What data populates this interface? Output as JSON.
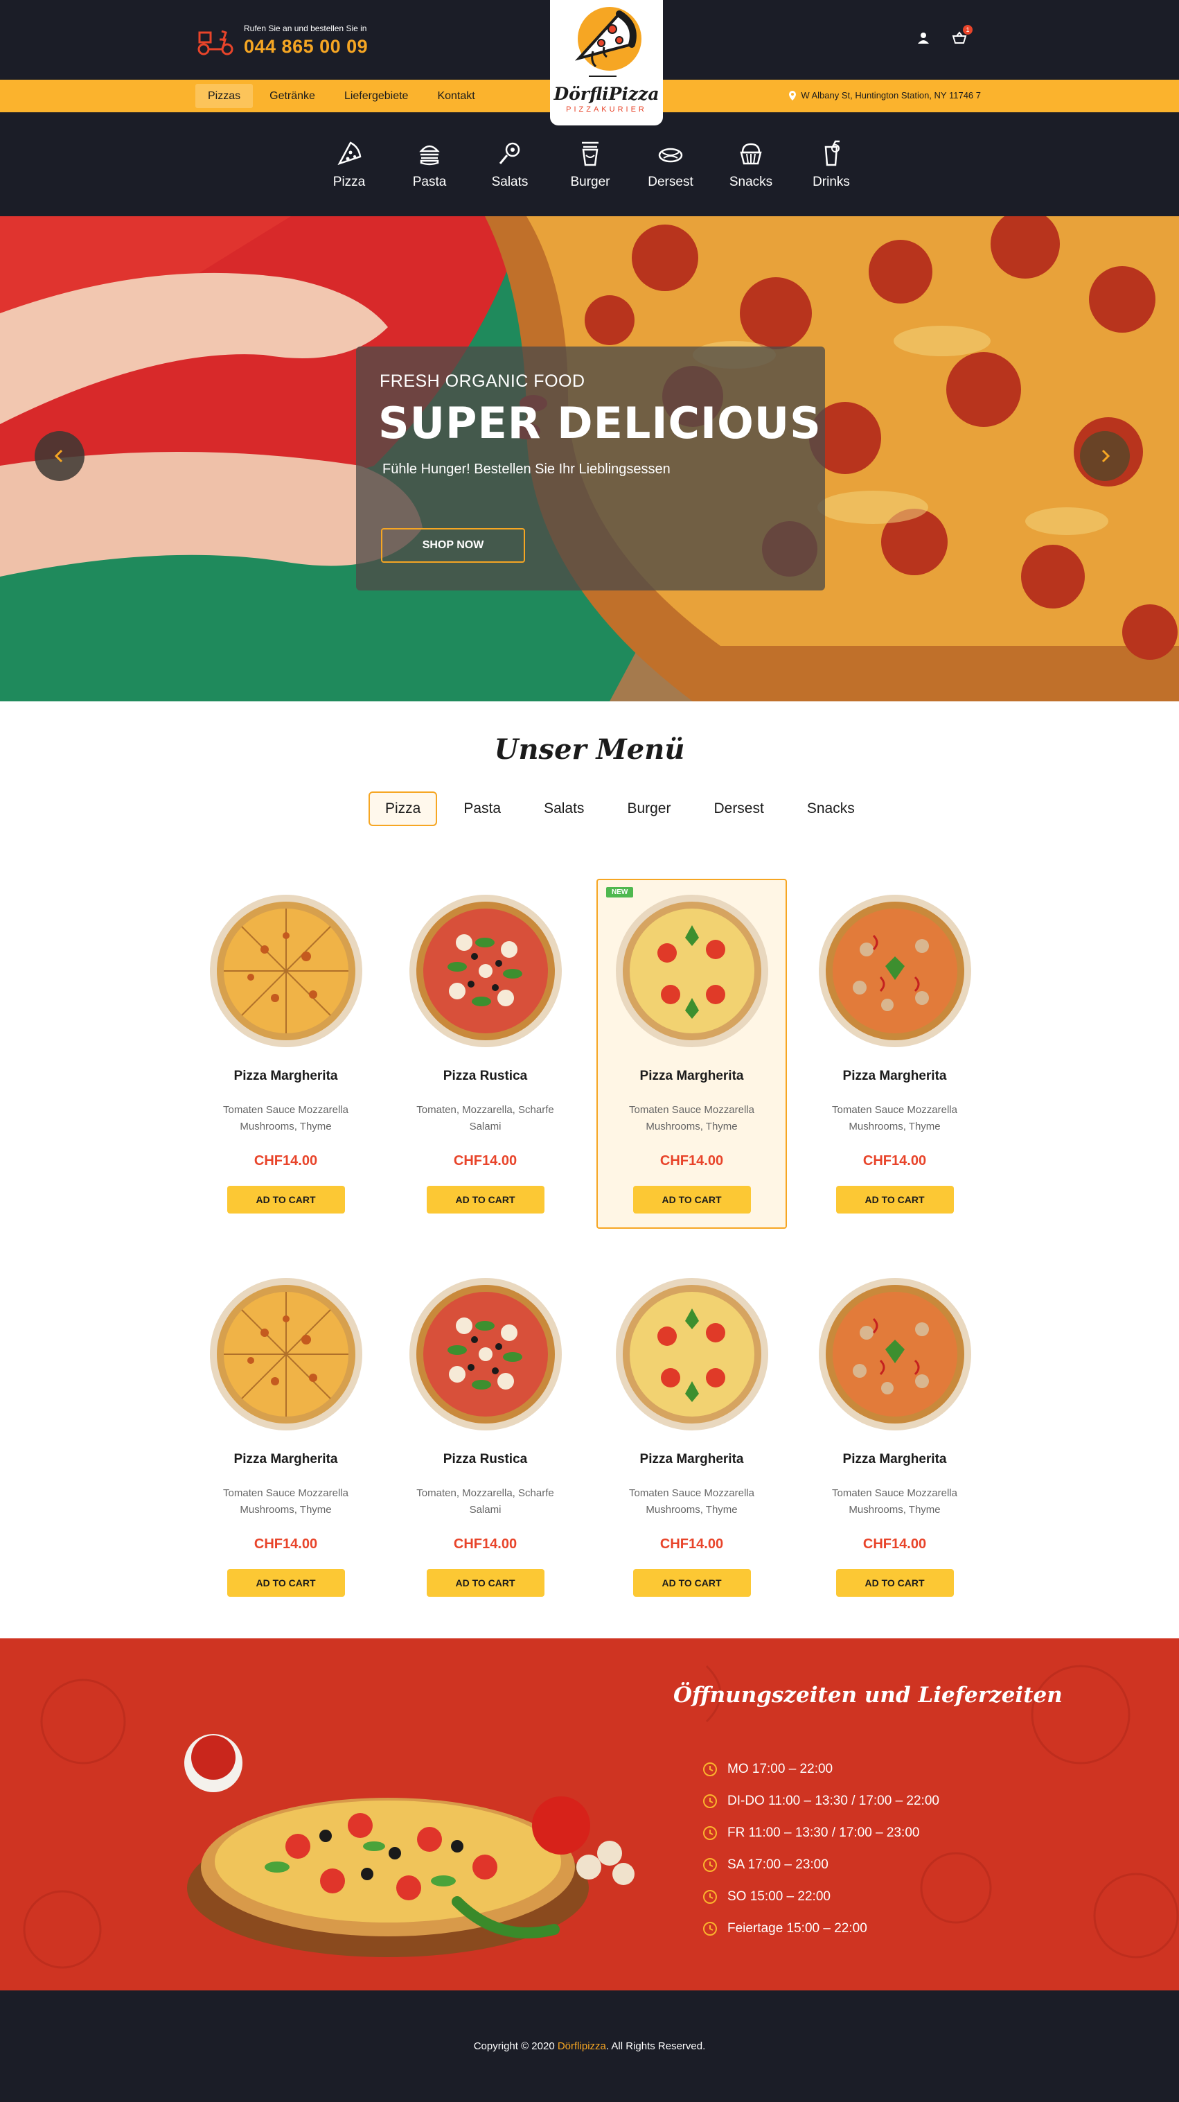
{
  "header": {
    "phone_label": "Rufen Sie an und bestellen Sie in",
    "phone_number": "044 865 00 09",
    "cart_count": "1"
  },
  "logo": {
    "name": "DörfliPizza",
    "tagline": "PIZZAKURIER"
  },
  "nav": {
    "items": [
      "Pizzas",
      "Getränke",
      "Liefergebiete",
      "Kontakt"
    ],
    "address": "W Albany St, Huntington Station, NY 11746 7"
  },
  "categories": [
    {
      "label": "Pizza",
      "icon": "pizza-slice-icon"
    },
    {
      "label": "Pasta",
      "icon": "burger-icon"
    },
    {
      "label": "Salats",
      "icon": "salad-icon"
    },
    {
      "label": "Burger",
      "icon": "fries-icon"
    },
    {
      "label": "Dersest",
      "icon": "dessert-icon"
    },
    {
      "label": "Snacks",
      "icon": "cupcake-icon"
    },
    {
      "label": "Drinks",
      "icon": "drink-icon"
    }
  ],
  "hero": {
    "eyebrow": "FRESH ORGANIC FOOD",
    "title": "SUPER DELICIOUS",
    "subtitle": "Fühle Hunger! Bestellen Sie Ihr Lieblingsessen",
    "button": "SHOP NOW"
  },
  "menu": {
    "title": "Unser Menü",
    "tabs": [
      "Pizza",
      "Pasta",
      "Salats",
      "Burger",
      "Dersest",
      "Snacks"
    ],
    "add_to_cart": "AD TO CART",
    "new_badge": "NEW",
    "items": [
      {
        "name": "Pizza Margherita",
        "desc": "Tomaten Sauce  Mozzarella Mushrooms, Thyme",
        "price": "CHF14.00"
      },
      {
        "name": "Pizza Rustica",
        "desc": "Tomaten, Mozzarella, Scharfe Salami",
        "price": "CHF14.00"
      },
      {
        "name": "Pizza Margherita",
        "desc": "Tomaten Sauce  Mozzarella Mushrooms, Thyme",
        "price": "CHF14.00"
      },
      {
        "name": "Pizza Margherita",
        "desc": "Tomaten Sauce  Mozzarella Mushrooms, Thyme",
        "price": "CHF14.00"
      },
      {
        "name": "Pizza Margherita",
        "desc": "Tomaten Sauce  Mozzarella Mushrooms, Thyme",
        "price": "CHF14.00"
      },
      {
        "name": "Pizza Rustica",
        "desc": "Tomaten, Mozzarella, Scharfe Salami",
        "price": "CHF14.00"
      },
      {
        "name": "Pizza Margherita",
        "desc": "Tomaten Sauce  Mozzarella Mushrooms, Thyme",
        "price": "CHF14.00"
      },
      {
        "name": "Pizza Margherita",
        "desc": "Tomaten Sauce  Mozzarella Mushrooms, Thyme",
        "price": "CHF14.00"
      }
    ]
  },
  "hours": {
    "title": "Öffnungszeiten und Lieferzeiten",
    "lines": [
      "MO 17:00 – 22:00",
      "DI-DO 11:00 – 13:30 / 17:00 – 22:00",
      "FR 11:00 – 13:30 / 17:00 – 23:00",
      "SA 17:00 – 23:00",
      "SO 15:00 – 22:00",
      "Feiertage 15:00 – 22:00"
    ]
  },
  "footer": {
    "prefix": "Copyright © 2020 ",
    "brand": "Dörflipizza",
    "suffix": ". All Rights Reserved."
  },
  "colors": {
    "dark": "#1b1d27",
    "accent": "#fbb32d",
    "price": "#e8442a",
    "hours_bg": "#cf3422"
  }
}
